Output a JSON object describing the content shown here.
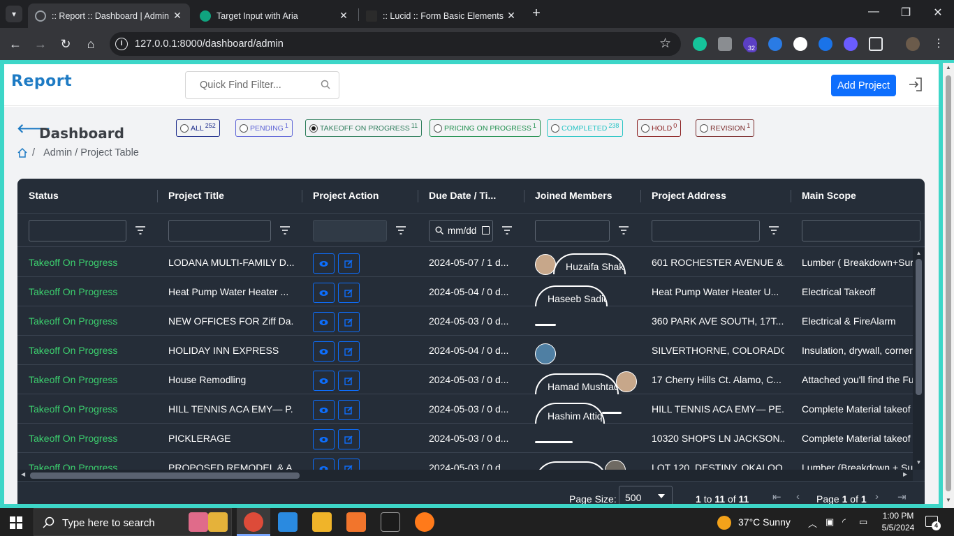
{
  "browser": {
    "tabs": [
      {
        "title": ":: Report :: Dashboard | Admin |",
        "active": true
      },
      {
        "title": "Target Input with Aria",
        "active": false
      },
      {
        "title": ":: Lucid :: Form Basic Elements",
        "active": false
      }
    ],
    "url": "127.0.0.1:8000/dashboard/admin",
    "extension_badge": "32"
  },
  "app": {
    "logo": "Report",
    "search_placeholder": "Quick Find Filter...",
    "add_button": "Add Project",
    "page_title": "Dashboard",
    "breadcrumb": "Admin / Project Table",
    "breadcrumb_sep": "/"
  },
  "filters": [
    {
      "label": "ALL",
      "count": "252",
      "color": "#1b2a8a",
      "checked": false
    },
    {
      "label": "PENDING",
      "count": "1",
      "color": "#5c62d6",
      "checked": false
    },
    {
      "label": "TAKEOFF ON PROGRESS",
      "count": "11",
      "color": "#2e7d5b",
      "checked": true
    },
    {
      "label": "PRICING ON PROGRESS",
      "count": "1",
      "color": "#1f8f4d",
      "checked": false
    },
    {
      "label": "COMPLETED",
      "count": "238",
      "color": "#27c4c4",
      "checked": false
    },
    {
      "label": "HOLD",
      "count": "0",
      "color": "#8b2020",
      "checked": false
    },
    {
      "label": "REVISION",
      "count": "1",
      "color": "#7a2b2b",
      "checked": false
    }
  ],
  "grid": {
    "columns": [
      "Status",
      "Project Title",
      "Project Action",
      "Due Date / Ti...",
      "Joined Members",
      "Project Address",
      "Main Scope"
    ],
    "date_filter": "mm/dd",
    "rows": [
      {
        "status": "Takeoff On Progress",
        "title": "LODANA MULTI-FAMILY D...",
        "due": "2024-05-07 / 1 d...",
        "member": "Huzaifa Shakir",
        "address": "601 ROCHESTER AVENUE &...",
        "scope": "Lumber ( Breakdown+Sur"
      },
      {
        "status": "Takeoff On Progress",
        "title": "Heat Pump Water Heater ...",
        "due": "2024-05-04 / 0 d...",
        "member": "Haseeb Sadiq",
        "address": "Heat Pump Water Heater U...",
        "scope": "Electrical Takeoff"
      },
      {
        "status": "Takeoff On Progress",
        "title": "NEW OFFICES FOR Ziff Da...",
        "due": "2024-05-03 / 0 d...",
        "member": "",
        "address": "360 PARK AVE SOUTH, 17T...",
        "scope": "Electrical & FireAlarm"
      },
      {
        "status": "Takeoff On Progress",
        "title": "HOLIDAY INN EXPRESS",
        "due": "2024-05-04 / 0 d...",
        "member": "",
        "address": "SILVERTHORNE, COLORADO",
        "scope": "Insulation, drywall, corner"
      },
      {
        "status": "Takeoff On Progress",
        "title": "House Remodling",
        "due": "2024-05-03 / 0 d...",
        "member": "Hamad Mushtaq",
        "address": "17 Cherry Hills Ct. Alamo, C...",
        "scope": "Attached you'll find the Fu"
      },
      {
        "status": "Takeoff On Progress",
        "title": "HILL TENNIS ACA EMY— P...",
        "due": "2024-05-03 / 0 d...",
        "member": "Hashim Attiq",
        "address": "HILL TENNIS ACA EMY— PE...",
        "scope": "Complete Material takeof"
      },
      {
        "status": "Takeoff On Progress",
        "title": "PICKLERAGE",
        "due": "2024-05-03 / 0 d...",
        "member": "",
        "address": "10320 SHOPS LN JACKSON...",
        "scope": "Complete Material takeof"
      },
      {
        "status": "Takeoff On Progress",
        "title": "PROPOSED REMODEL & A...",
        "due": "2024-05-03 / 0 d...",
        "member": "",
        "address": "LOT 120, DESTINY, OKALOO...",
        "scope": "Lumber (Breakdown + Su"
      }
    ]
  },
  "pager": {
    "page_size_label": "Page Size:",
    "page_size": "500",
    "range_from": "1",
    "range_to": "11",
    "range_total": "11",
    "range_to_word": "to",
    "range_of_word": "of",
    "page_word": "Page",
    "page_current": "1",
    "page_of_word": "of",
    "page_total": "1"
  },
  "taskbar": {
    "search_placeholder": "Type here to search",
    "weather": "37°C  Sunny",
    "time": "1:00 PM",
    "date": "5/5/2024",
    "notifications": "4"
  }
}
